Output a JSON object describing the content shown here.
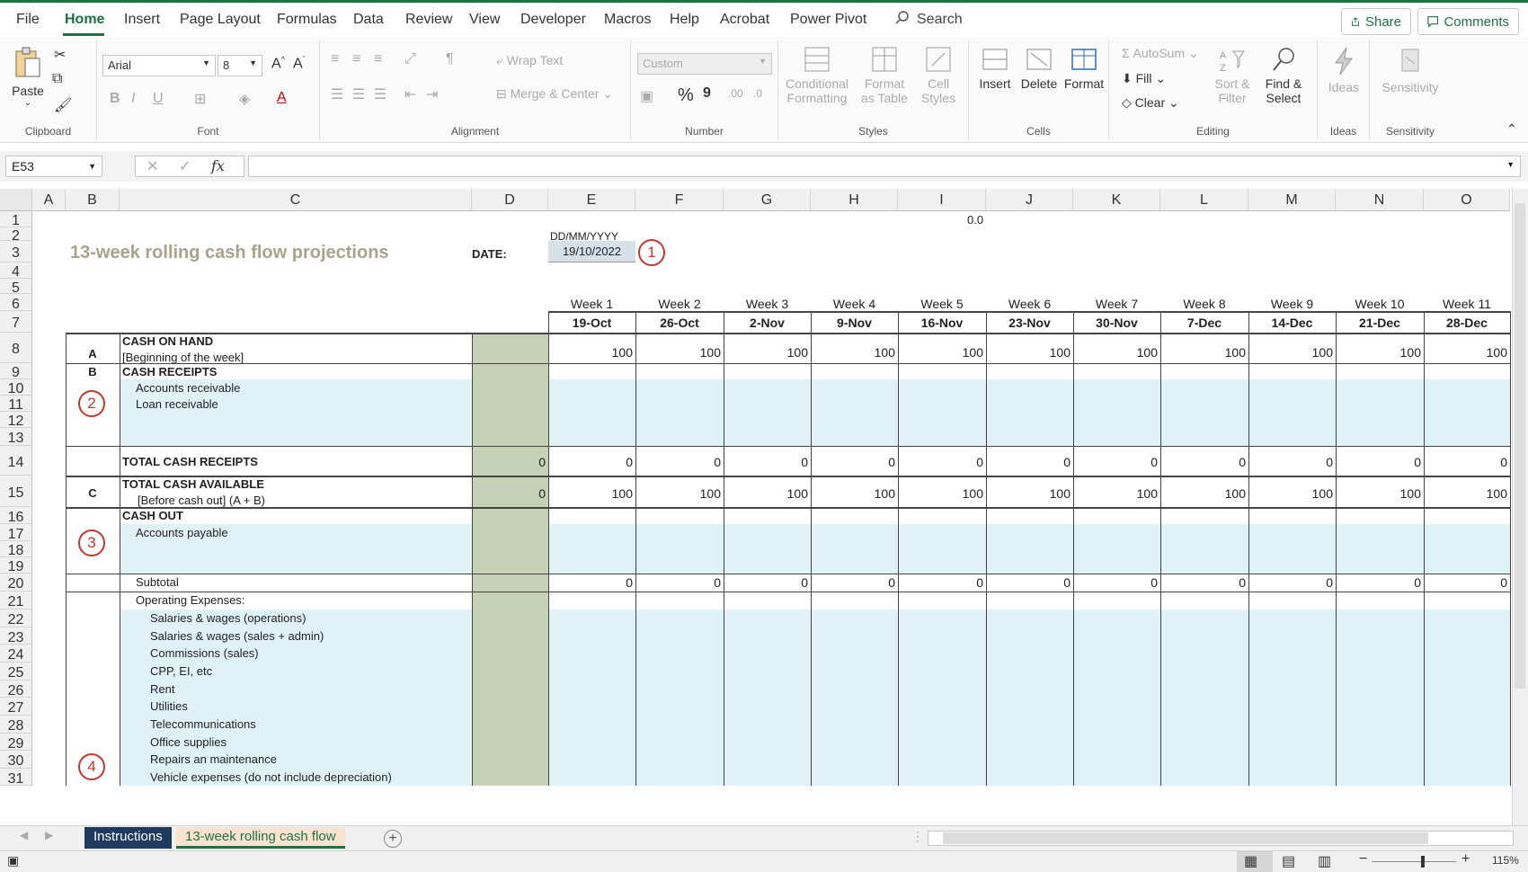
{
  "menu": {
    "items": [
      "File",
      "Home",
      "Insert",
      "Page Layout",
      "Formulas",
      "Data",
      "Review",
      "View",
      "Developer",
      "Macros",
      "Help",
      "Acrobat",
      "Power Pivot"
    ],
    "search": "Search",
    "share": "Share",
    "comments": "Comments"
  },
  "ribbon": {
    "clipboard": {
      "paste": "Paste",
      "label": "Clipboard"
    },
    "font": {
      "name": "Arial",
      "size": "8",
      "label": "Font",
      "bold": "B",
      "italic": "I",
      "underline": "U"
    },
    "alignment": {
      "wrap": "Wrap Text",
      "merge": "Merge & Center",
      "label": "Alignment"
    },
    "number": {
      "format": "Custom",
      "label": "Number",
      "percent": "%",
      "comma": "9"
    },
    "styles": {
      "conditional": "Conditional Formatting",
      "format_table": "Format as Table",
      "cell_styles": "Cell Styles",
      "label": "Styles"
    },
    "cells": {
      "insert": "Insert",
      "delete": "Delete",
      "format": "Format",
      "label": "Cells"
    },
    "editing": {
      "autosum": "AutoSum",
      "fill": "Fill",
      "clear": "Clear",
      "sort": "Sort & Filter",
      "find": "Find & Select",
      "label": "Editing"
    },
    "ideas": {
      "button": "Ideas",
      "label": "Ideas"
    },
    "sensitivity": {
      "button": "Sensitivity",
      "label": "Sensitivity"
    }
  },
  "formula_bar": {
    "name_box": "E53",
    "fx": "fx",
    "value": ""
  },
  "sheet": {
    "columns": [
      "A",
      "B",
      "C",
      "D",
      "E",
      "F",
      "G",
      "H",
      "I",
      "J",
      "K",
      "L",
      "M",
      "N",
      "O"
    ],
    "rows": [
      "1",
      "2",
      "3",
      "4",
      "5",
      "6",
      "7",
      "8",
      "9",
      "10",
      "11",
      "12",
      "13",
      "14",
      "15",
      "16",
      "17",
      "18",
      "19",
      "20",
      "21",
      "22",
      "23",
      "24",
      "25",
      "26",
      "27",
      "28",
      "29",
      "30",
      "31"
    ],
    "title": "13-week rolling cash flow projections",
    "date_label": "DATE:",
    "date_format": "DD/MM/YYYY",
    "date_value": "19/10/2022",
    "top_value": "0.0",
    "weeks": [
      "Week 1",
      "Week 2",
      "Week 3",
      "Week 4",
      "Week 5",
      "Week 6",
      "Week 7",
      "Week 8",
      "Week 9",
      "Week 10",
      "Week 11"
    ],
    "dates": [
      "19-Oct",
      "26-Oct",
      "2-Nov",
      "9-Nov",
      "16-Nov",
      "23-Nov",
      "30-Nov",
      "7-Dec",
      "14-Dec",
      "21-Dec",
      "28-Dec"
    ],
    "sections": {
      "a_letter": "A",
      "a_title": "CASH ON HAND",
      "a_sub": "[Beginning of the week]",
      "b_letter": "B",
      "b_title": "CASH RECEIPTS",
      "b_item1": "Accounts receivable",
      "b_item2": "Loan receivable",
      "total_receipts": "TOTAL CASH RECEIPTS",
      "c_letter": "C",
      "total_available": "TOTAL CASH AVAILABLE",
      "total_available_sub": "[Before cash out] (A + B)",
      "cash_out": "CASH OUT",
      "accounts_payable": "Accounts payable",
      "subtotal": "Subtotal",
      "operating": "Operating Expenses:",
      "expenses": [
        "Salaries & wages (operations)",
        "Salaries & wages (sales + admin)",
        "Commissions (sales)",
        "CPP, EI, etc",
        "Rent",
        "Utilities",
        "Telecommunications",
        "Office supplies",
        "Repairs an maintenance",
        "Vehicle expenses (do not include depreciation)"
      ]
    },
    "values": {
      "cash_on_hand": [
        "100",
        "100",
        "100",
        "100",
        "100",
        "100",
        "100",
        "100",
        "100",
        "100",
        "100"
      ],
      "total_receipts_d": "0",
      "total_receipts": [
        "0",
        "0",
        "0",
        "0",
        "0",
        "0",
        "0",
        "0",
        "0",
        "0",
        "0"
      ],
      "total_available_d": "0",
      "total_available": [
        "100",
        "100",
        "100",
        "100",
        "100",
        "100",
        "100",
        "100",
        "100",
        "100",
        "100"
      ],
      "subtotal": [
        "0",
        "0",
        "0",
        "0",
        "0",
        "0",
        "0",
        "0",
        "0",
        "0",
        "0"
      ]
    },
    "callouts": [
      "1",
      "2",
      "3",
      "4"
    ]
  },
  "tabs": {
    "instructions": "Instructions",
    "active": "13-week rolling cash flow"
  },
  "status": {
    "zoom": "115%"
  },
  "colors": {
    "accent": "#1e7145",
    "band": "#dff2f8",
    "olive": "#c6d1b6",
    "title": "#a8a38a",
    "callout": "#c0392b"
  }
}
